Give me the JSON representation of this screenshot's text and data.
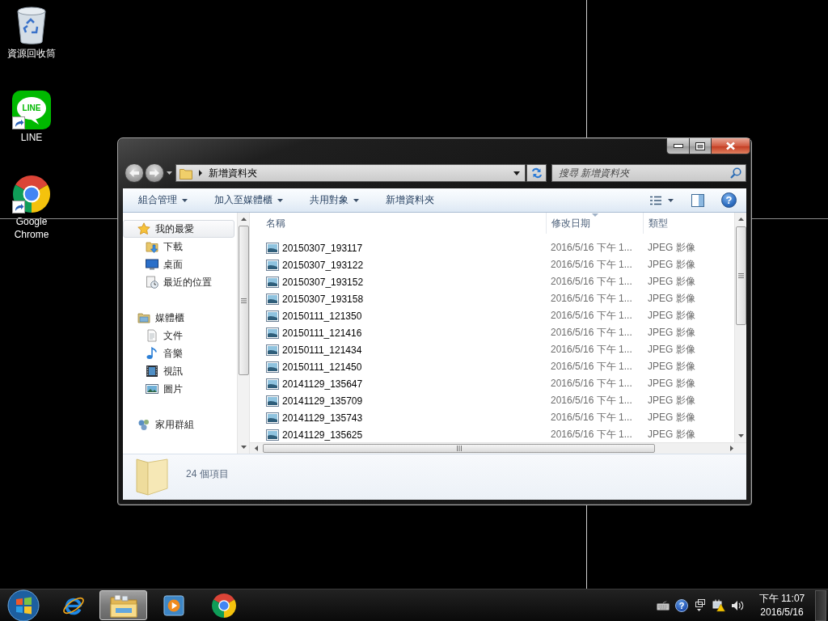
{
  "desktop": {
    "icons": [
      {
        "kind": "recycle_bin",
        "label": "資源回收筒",
        "shortcut": false
      },
      {
        "kind": "line",
        "label": "LINE",
        "logo_text": "LINE",
        "shortcut": true
      },
      {
        "kind": "chrome",
        "label": "Google Chrome",
        "shortcut": true
      }
    ]
  },
  "explorer": {
    "breadcrumb": [
      "新增資料夾"
    ],
    "search": {
      "placeholder": "搜尋 新增資料夾"
    },
    "toolbar": [
      {
        "label": "組合管理",
        "dropdown": true
      },
      {
        "label": "加入至媒體櫃",
        "dropdown": true
      },
      {
        "label": "共用對象",
        "dropdown": true
      },
      {
        "label": "新增資料夾",
        "dropdown": false
      }
    ],
    "help": {
      "glyph": "?"
    },
    "navigation": [
      {
        "kind": "favorites",
        "label": "我的最愛",
        "selected": true,
        "children": [
          {
            "kind": "downloads",
            "label": "下載",
            "selected": false
          },
          {
            "kind": "desktop",
            "label": "桌面",
            "selected": false
          },
          {
            "kind": "recent",
            "label": "最近的位置",
            "selected": false
          }
        ]
      },
      {
        "kind": "libraries",
        "label": "媒體櫃",
        "selected": false,
        "children": [
          {
            "kind": "documents",
            "label": "文件",
            "selected": false
          },
          {
            "kind": "music",
            "label": "音樂",
            "selected": false
          },
          {
            "kind": "videos",
            "label": "視訊",
            "selected": false
          },
          {
            "kind": "pictures",
            "label": "圖片",
            "selected": false
          }
        ]
      },
      {
        "kind": "homegroup",
        "label": "家用群組",
        "selected": false
      }
    ],
    "table": {
      "columns": [
        {
          "label": "名稱",
          "sorted": false
        },
        {
          "label": "修改日期",
          "sorted": true
        },
        {
          "label": "類型",
          "sorted": false
        }
      ],
      "rows": [
        {
          "name": "20150307_193117",
          "modified": "2016/5/16 下午 1...",
          "type": "JPEG 影像"
        },
        {
          "name": "20150307_193122",
          "modified": "2016/5/16 下午 1...",
          "type": "JPEG 影像"
        },
        {
          "name": "20150307_193152",
          "modified": "2016/5/16 下午 1...",
          "type": "JPEG 影像"
        },
        {
          "name": "20150307_193158",
          "modified": "2016/5/16 下午 1...",
          "type": "JPEG 影像"
        },
        {
          "name": "20150111_121350",
          "modified": "2016/5/16 下午 1...",
          "type": "JPEG 影像"
        },
        {
          "name": "20150111_121416",
          "modified": "2016/5/16 下午 1...",
          "type": "JPEG 影像"
        },
        {
          "name": "20150111_121434",
          "modified": "2016/5/16 下午 1...",
          "type": "JPEG 影像"
        },
        {
          "name": "20150111_121450",
          "modified": "2016/5/16 下午 1...",
          "type": "JPEG 影像"
        },
        {
          "name": "20141129_135647",
          "modified": "2016/5/16 下午 1...",
          "type": "JPEG 影像"
        },
        {
          "name": "20141129_135709",
          "modified": "2016/5/16 下午 1...",
          "type": "JPEG 影像"
        },
        {
          "name": "20141129_135743",
          "modified": "2016/5/16 下午 1...",
          "type": "JPEG 影像"
        },
        {
          "name": "20141129_135625",
          "modified": "2016/5/16 下午 1...",
          "type": "JPEG 影像"
        }
      ]
    },
    "status": "24 個項目"
  },
  "taskbar": {
    "buttons": [
      {
        "kind": "internet_explorer",
        "active": false
      },
      {
        "kind": "file_explorer",
        "active": true
      },
      {
        "kind": "media_player",
        "active": false
      },
      {
        "kind": "chrome",
        "active": false
      }
    ],
    "tray": [
      {
        "kind": "keyboard"
      },
      {
        "kind": "help",
        "glyph": "?"
      },
      {
        "kind": "windows"
      },
      {
        "kind": "network_warning"
      },
      {
        "kind": "volume"
      }
    ],
    "clock": {
      "time": "下午 11:07",
      "date": "2016/5/16"
    }
  }
}
